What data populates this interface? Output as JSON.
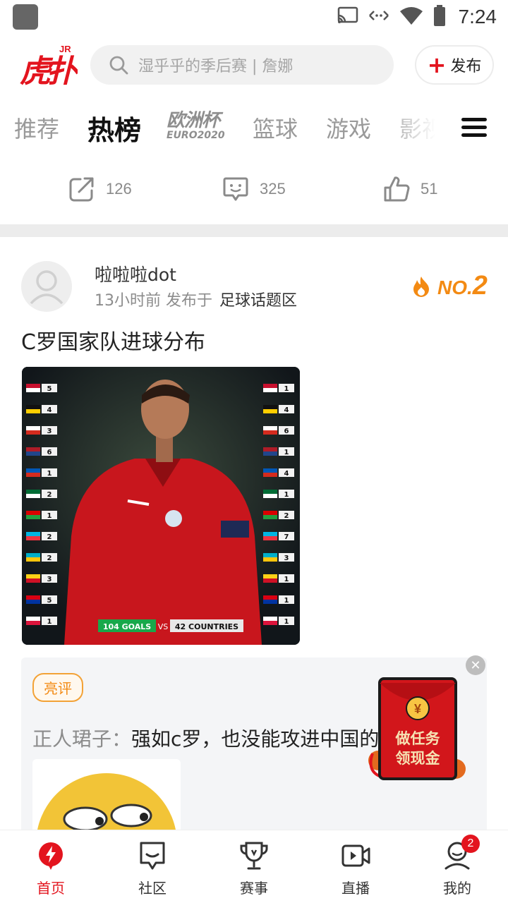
{
  "status_bar": {
    "time": "7:24",
    "icons": [
      "cast-icon",
      "data-arrows-icon",
      "wifi-icon",
      "battery-icon"
    ]
  },
  "header": {
    "logo_text": "虎扑",
    "logo_superscript": "JR",
    "search_placeholder": "湿乎乎的季后赛 | 詹娜",
    "publish_label": "发布"
  },
  "tabs": [
    {
      "label": "推荐",
      "active": false
    },
    {
      "label": "热榜",
      "active": true
    },
    {
      "label": "欧洲杯",
      "sub": "EURO2020",
      "active": false
    },
    {
      "label": "篮球",
      "active": false
    },
    {
      "label": "游戏",
      "active": false
    },
    {
      "label": "影视",
      "active": false
    }
  ],
  "actions": {
    "share_count": "126",
    "comment_count": "325",
    "like_count": "51"
  },
  "post": {
    "author": "啦啦啦dot",
    "time": "13小时前 发布于",
    "zone": "足球话题区",
    "rank_prefix": "NO.",
    "rank_number": "2",
    "title": "C罗国家队进球分布",
    "image_caption_left": "104 GOALS",
    "image_caption_vs": "VS",
    "image_caption_right": "42 COUNTRIES",
    "left_counts": [
      "5",
      "4",
      "3",
      "6",
      "1",
      "2",
      "1",
      "2",
      "2",
      "3",
      "5",
      "1"
    ],
    "right_counts": [
      "1",
      "4",
      "6",
      "1",
      "4",
      "1",
      "2",
      "7",
      "3",
      "1",
      "1",
      "1"
    ]
  },
  "comment": {
    "badge": "亮评",
    "user": "正人珺子：",
    "text": "强如c罗，也没能攻进中国的球门"
  },
  "envelope": {
    "line1": "做任务",
    "line2": "领现金",
    "coin": "¥"
  },
  "bottom_nav": [
    {
      "label": "首页",
      "active": true
    },
    {
      "label": "社区",
      "active": false
    },
    {
      "label": "赛事",
      "active": false
    },
    {
      "label": "直播",
      "active": false
    },
    {
      "label": "我的",
      "active": false,
      "badge": "2"
    }
  ],
  "colors": {
    "brand": "#e3141e",
    "rank": "#f38a13",
    "tab_inactive": "#9a9a9a",
    "divider": "#ececec"
  }
}
